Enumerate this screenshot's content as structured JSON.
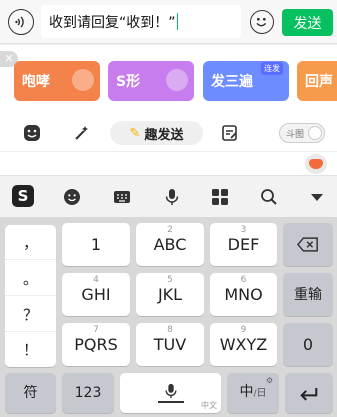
{
  "chat": {
    "input_text": "收到请回复“收到！”",
    "send_label": "发送"
  },
  "stickers": [
    {
      "label": "咆哮",
      "color": "#f3834a"
    },
    {
      "label": "S形",
      "color": "#c77ded"
    },
    {
      "label": "发三遍",
      "color": "#6c8cff",
      "badge": "连发"
    },
    {
      "label": "回声",
      "color": "#f69a4c"
    }
  ],
  "toolbar": {
    "fun_send_label": "趣发送",
    "doutu_label": "斗图"
  },
  "keyboard": {
    "punct": [
      "，",
      "。",
      "？",
      "！"
    ],
    "rows": [
      [
        {
          "num": "",
          "main": "1"
        },
        {
          "num": "2",
          "main": "ABC"
        },
        {
          "num": "3",
          "main": "DEF"
        }
      ],
      [
        {
          "num": "4",
          "main": "GHI"
        },
        {
          "num": "5",
          "main": "JKL"
        },
        {
          "num": "6",
          "main": "MNO"
        }
      ],
      [
        {
          "num": "7",
          "main": "PQRS"
        },
        {
          "num": "8",
          "main": "TUV"
        },
        {
          "num": "9",
          "main": "WXYZ"
        }
      ]
    ],
    "reinput_label": "重输",
    "zero_label": "0",
    "symbol_label": "符",
    "num_switch_label": "123",
    "space_sub_label": "中文",
    "lang_label": "中",
    "lang_sub_label": "日",
    "accent_color": "#07c160"
  }
}
